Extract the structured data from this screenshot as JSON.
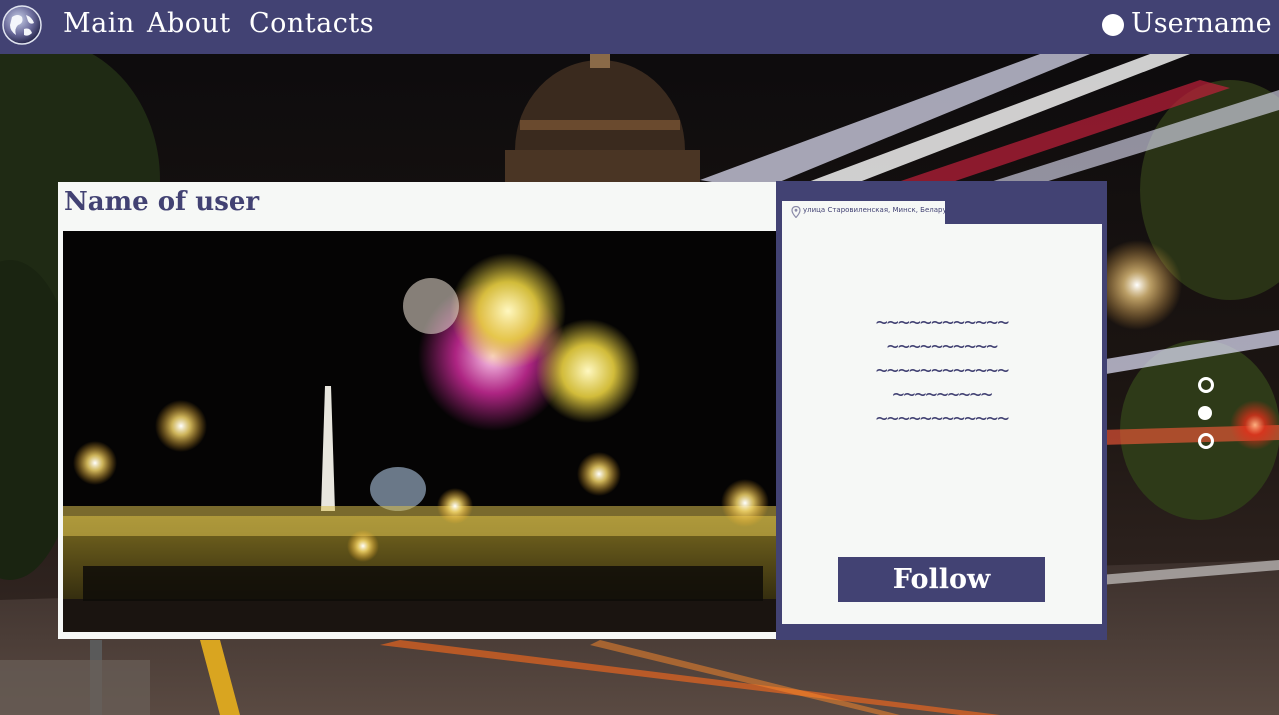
{
  "nav": {
    "links": [
      "Main",
      "About",
      "Contacts"
    ],
    "user_label": "Username"
  },
  "profile": {
    "name": "Name of user",
    "location": "улица Старовиленская, Минск, Белару",
    "info_lines": [
      "~~~~~~~~~~~~",
      "~~~~~~~~~~",
      "~~~~~~~~~~~~",
      "~~~~~~~~~",
      "~~~~~~~~~~~~"
    ],
    "follow_label": "Follow"
  },
  "slider": {
    "dots": [
      "hollow",
      "filled",
      "hollow"
    ],
    "active_index": 1
  },
  "colors": {
    "primary": "#424273",
    "panel": "#f6f8f6",
    "text_on_primary": "#ffffff"
  },
  "icons": {
    "logo": "globe-icon",
    "user": "user-circle-icon",
    "location": "map-pin-icon"
  }
}
